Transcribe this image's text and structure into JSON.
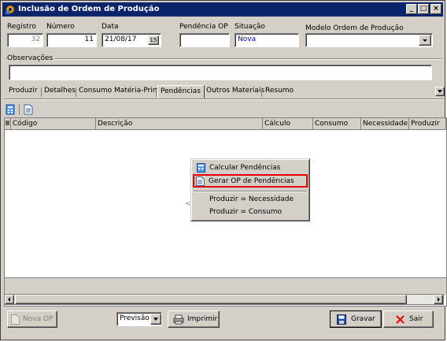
{
  "window": {
    "title": "Inclusão de Ordem de Produção",
    "controls": [
      "_",
      "□",
      "×"
    ]
  },
  "header": {
    "registro": {
      "label": "Registro",
      "value": "32"
    },
    "numero": {
      "label": "Número",
      "value": "11"
    },
    "data": {
      "label": "Data",
      "value": "21/08/17",
      "cal_btn": "15"
    },
    "pendencia_op": {
      "label": "Pendência OP",
      "value": ""
    },
    "situacao": {
      "label": "Situação",
      "value": "Nova"
    },
    "modelo": {
      "label": "Modelo Ordem de Produção",
      "value": ""
    }
  },
  "observacoes": {
    "label": "Observações",
    "value": ""
  },
  "tabs": [
    {
      "label": "Produzir"
    },
    {
      "label": "Detalhes"
    },
    {
      "label": "Consumo Matéria-Prima"
    },
    {
      "label": "Pendências"
    },
    {
      "label": "Outros Materiais"
    },
    {
      "label": "Resumo"
    }
  ],
  "grid": {
    "columns": [
      "Código",
      "Descrição",
      "Cálculo",
      "Consumo",
      "Necessidade",
      "Produzir"
    ],
    "empty_hint": "<S"
  },
  "context_menu": {
    "items": [
      {
        "label": "Calcular Pendências",
        "icon": "calculator-icon"
      },
      {
        "label": "Gerar OP de Pendências",
        "icon": "document-icon",
        "highlighted": true
      },
      {
        "label": "Produzir = Necessidade"
      },
      {
        "label": "Produzir = Consumo"
      }
    ]
  },
  "footer": {
    "nova_op": "Nova OP",
    "previsao": "Previsão",
    "imprimir": "Imprimir",
    "gravar": "Gravar",
    "sair": "Sair"
  },
  "colors": {
    "title_bar": "#0a246a",
    "highlight_border": "#e00000",
    "situacao_text": "#0000cc"
  }
}
